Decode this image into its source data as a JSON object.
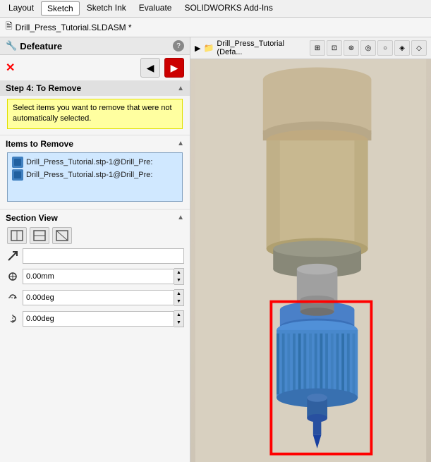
{
  "menu": {
    "items": [
      "Layout",
      "Sketch",
      "Sketch Ink",
      "Evaluate",
      "SOLIDWORKS Add-Ins"
    ]
  },
  "title_bar": {
    "icon": "📋",
    "text": "Drill_Press_Tutorial.SLDASM *"
  },
  "left_panel": {
    "panel_name": "Defeature",
    "help_icon": "?",
    "x_button": "✕",
    "back_button": "◀",
    "forward_button": "▶",
    "step4": {
      "label": "Step 4: To Remove",
      "info_text": "Select items you want to remove that were not automatically selected."
    },
    "items_to_remove": {
      "label": "Items to Remove",
      "items": [
        "Drill_Press_Tutorial.stp-1@Drill_Pre:",
        "Drill_Press_Tutorial.stp-1@Drill_Pre:"
      ]
    },
    "section_view": {
      "label": "Section View",
      "buttons": [
        "⬜",
        "⬜",
        "⬜"
      ]
    },
    "input_rows": [
      {
        "icon": "↗",
        "value": "",
        "has_spinner": false
      },
      {
        "icon": "⊕",
        "value": "0.00mm",
        "has_spinner": true
      },
      {
        "icon": "↺",
        "value": "0.00deg",
        "has_spinner": true
      },
      {
        "icon": "↻",
        "value": "0.00deg",
        "has_spinner": true
      }
    ]
  },
  "right_panel": {
    "tree_icon": "📁",
    "title": "Drill_Press_Tutorial (Defa...",
    "toolbar_buttons": [
      "⊞",
      "⊟",
      "⊛",
      "◎",
      "○",
      "◈",
      "◇"
    ]
  }
}
